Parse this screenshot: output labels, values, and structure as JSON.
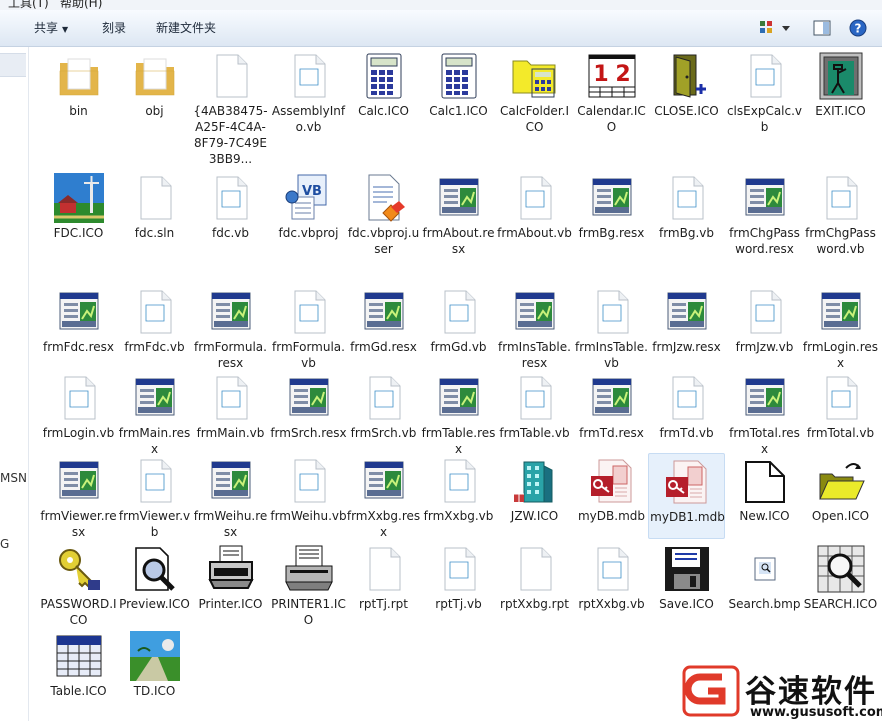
{
  "menu": {
    "tools": "工具(T)",
    "help": "帮助(H)"
  },
  "toolbar": {
    "share": "共享",
    "burn": "刻录",
    "new_folder": "新建文件夹"
  },
  "nav_fragments": [
    "MSN",
    "G"
  ],
  "files": [
    {
      "name": "bin",
      "icon": "folder"
    },
    {
      "name": "obj",
      "icon": "folder"
    },
    {
      "name": "{4AB38475-A25F-4C4A-8F79-7C49E3BB9...",
      "icon": "blank"
    },
    {
      "name": "AssemblyInfo.vb",
      "icon": "vbfile"
    },
    {
      "name": "Calc.ICO",
      "icon": "calc"
    },
    {
      "name": "Calc1.ICO",
      "icon": "calc"
    },
    {
      "name": "CalcFolder.ICO",
      "icon": "calcfolder"
    },
    {
      "name": "Calendar.ICO",
      "icon": "calendar"
    },
    {
      "name": "CLOSE.ICO",
      "icon": "closedoor"
    },
    {
      "name": "clsExpCalc.vb",
      "icon": "vbfile"
    },
    {
      "name": "EXIT.ICO",
      "icon": "exit"
    },
    {
      "name": "FDC.ICO",
      "icon": "farm"
    },
    {
      "name": "fdc.sln",
      "icon": "blank"
    },
    {
      "name": "fdc.vb",
      "icon": "vbfile"
    },
    {
      "name": "fdc.vbproj",
      "icon": "vbproj"
    },
    {
      "name": "fdc.vbproj.user",
      "icon": "vbuser"
    },
    {
      "name": "frmAbout.resx",
      "icon": "resx"
    },
    {
      "name": "frmAbout.vb",
      "icon": "vbfile"
    },
    {
      "name": "frmBg.resx",
      "icon": "resx"
    },
    {
      "name": "frmBg.vb",
      "icon": "vbfile"
    },
    {
      "name": "frmChgPassword.resx",
      "icon": "resx"
    },
    {
      "name": "frmChgPassword.vb",
      "icon": "vbfile"
    },
    {
      "name": "frmFdc.resx",
      "icon": "resx"
    },
    {
      "name": "frmFdc.vb",
      "icon": "vbfile"
    },
    {
      "name": "frmFormula.resx",
      "icon": "resx"
    },
    {
      "name": "frmFormula.vb",
      "icon": "vbfile"
    },
    {
      "name": "frmGd.resx",
      "icon": "resx"
    },
    {
      "name": "frmGd.vb",
      "icon": "vbfile"
    },
    {
      "name": "frmInsTable.resx",
      "icon": "resx"
    },
    {
      "name": "frmInsTable.vb",
      "icon": "vbfile"
    },
    {
      "name": "frmJzw.resx",
      "icon": "resx"
    },
    {
      "name": "frmJzw.vb",
      "icon": "vbfile"
    },
    {
      "name": "frmLogin.resx",
      "icon": "resx"
    },
    {
      "name": "frmLogin.vb",
      "icon": "vbfile"
    },
    {
      "name": "frmMain.resx",
      "icon": "resx"
    },
    {
      "name": "frmMain.vb",
      "icon": "vbfile"
    },
    {
      "name": "frmSrch.resx",
      "icon": "resx"
    },
    {
      "name": "frmSrch.vb",
      "icon": "vbfile"
    },
    {
      "name": "frmTable.resx",
      "icon": "resx"
    },
    {
      "name": "frmTable.vb",
      "icon": "vbfile"
    },
    {
      "name": "frmTd.resx",
      "icon": "resx"
    },
    {
      "name": "frmTd.vb",
      "icon": "vbfile"
    },
    {
      "name": "frmTotal.resx",
      "icon": "resx"
    },
    {
      "name": "frmTotal.vb",
      "icon": "vbfile"
    },
    {
      "name": "frmViewer.resx",
      "icon": "resx"
    },
    {
      "name": "frmViewer.vb",
      "icon": "vbfile"
    },
    {
      "name": "frmWeihu.resx",
      "icon": "resx"
    },
    {
      "name": "frmWeihu.vb",
      "icon": "vbfile"
    },
    {
      "name": "frmXxbg.resx",
      "icon": "resx"
    },
    {
      "name": "frmXxbg.vb",
      "icon": "vbfile"
    },
    {
      "name": "JZW.ICO",
      "icon": "building"
    },
    {
      "name": "myDB.mdb",
      "icon": "mdb"
    },
    {
      "name": "myDB1.mdb",
      "icon": "mdb",
      "selected": true
    },
    {
      "name": "New.ICO",
      "icon": "newdoc"
    },
    {
      "name": "Open.ICO",
      "icon": "openfolder"
    },
    {
      "name": "PASSWORD.ICO",
      "icon": "key"
    },
    {
      "name": "Preview.ICO",
      "icon": "preview"
    },
    {
      "name": "Printer.ICO",
      "icon": "printer"
    },
    {
      "name": "PRINTER1.ICO",
      "icon": "printer1"
    },
    {
      "name": "rptTj.rpt",
      "icon": "blank"
    },
    {
      "name": "rptTj.vb",
      "icon": "vbfile"
    },
    {
      "name": "rptXxbg.rpt",
      "icon": "blank"
    },
    {
      "name": "rptXxbg.vb",
      "icon": "vbfile"
    },
    {
      "name": "Save.ICO",
      "icon": "floppy"
    },
    {
      "name": "Search.bmp",
      "icon": "bmp"
    },
    {
      "name": "SEARCH.ICO",
      "icon": "searchico"
    },
    {
      "name": "Table.ICO",
      "icon": "table"
    },
    {
      "name": "TD.ICO",
      "icon": "landscape"
    }
  ],
  "watermark": {
    "name": "谷速软件",
    "url": "www.gususoft.com"
  }
}
